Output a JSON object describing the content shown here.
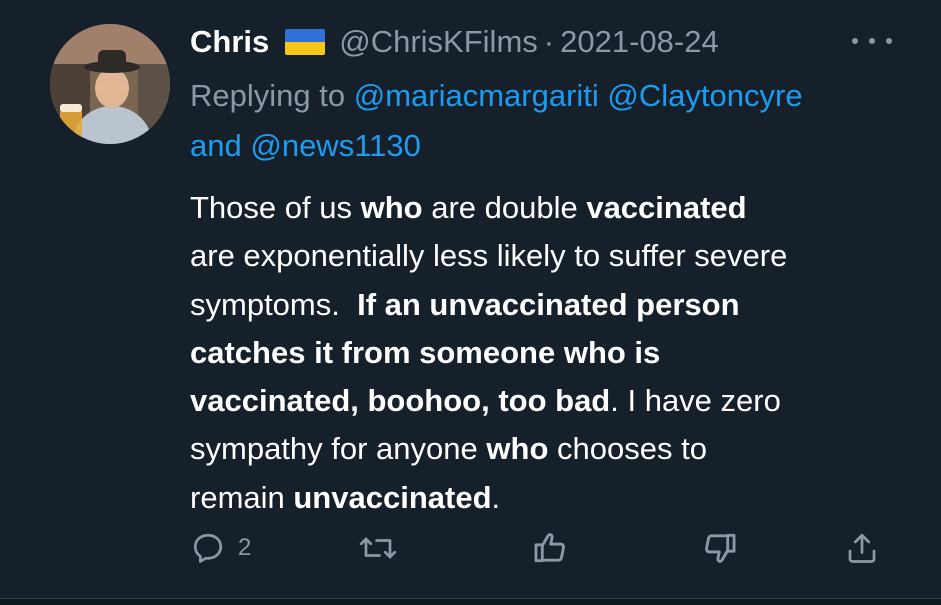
{
  "tweet": {
    "author_name": "Chris",
    "author_flag": "ukraine-flag-icon",
    "author_handle": "@ChrisKFilms",
    "separator": "·",
    "date": "2021-08-24",
    "replying_prefix": "Replying to",
    "mention_1": "@mariacmargariti",
    "mention_2": "@Claytoncyre",
    "and_word": "and",
    "mention_3": "@news1130",
    "body": {
      "l1_a": "Those of us ",
      "l1_b": "who",
      "l1_c": " are double ",
      "l1_d": "vaccinated",
      "l2": "are exponentially less likely to suffer severe",
      "l3_a": "symptoms.  ",
      "l3_b": "If an unvaccinated person",
      "l4": "catches it from someone who is",
      "l5_a": "vaccinated, boohoo, too bad",
      "l5_b": ". I have zero",
      "l6_a": "sympathy for anyone ",
      "l6_b": "who",
      "l6_c": " chooses to",
      "l7_a": "remain ",
      "l7_b": "unvaccinated",
      "l7_c": "."
    },
    "actions": {
      "reply_count": "2",
      "reply_icon": "reply-icon",
      "retweet_icon": "retweet-icon",
      "like_icon": "thumbs-up-icon",
      "dislike_icon": "thumbs-down-icon",
      "share_icon": "share-icon"
    }
  },
  "colors": {
    "background": "#15202b",
    "text_primary": "#ffffff",
    "text_secondary": "#8b98a5",
    "link": "#1d9bf0"
  }
}
